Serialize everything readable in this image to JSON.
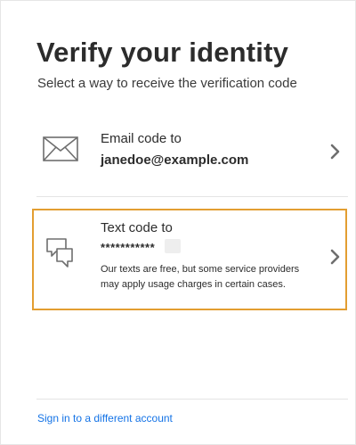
{
  "heading": {
    "title": "Verify your identity",
    "subtitle": "Select a way to receive the verification code"
  },
  "options": [
    {
      "icon": "envelope-icon",
      "label": "Email code to",
      "value": "janedoe@example.com"
    },
    {
      "icon": "chat-bubbles-icon",
      "label": "Text code to",
      "value": "***********",
      "note": "Our texts are free, but some service providers may apply usage charges in certain cases.",
      "selected": true
    }
  ],
  "footer": {
    "switch_account": "Sign in to a different account"
  },
  "colors": {
    "accent_border": "#e39e31",
    "link": "#1473e6",
    "text": "#2c2c2c"
  }
}
